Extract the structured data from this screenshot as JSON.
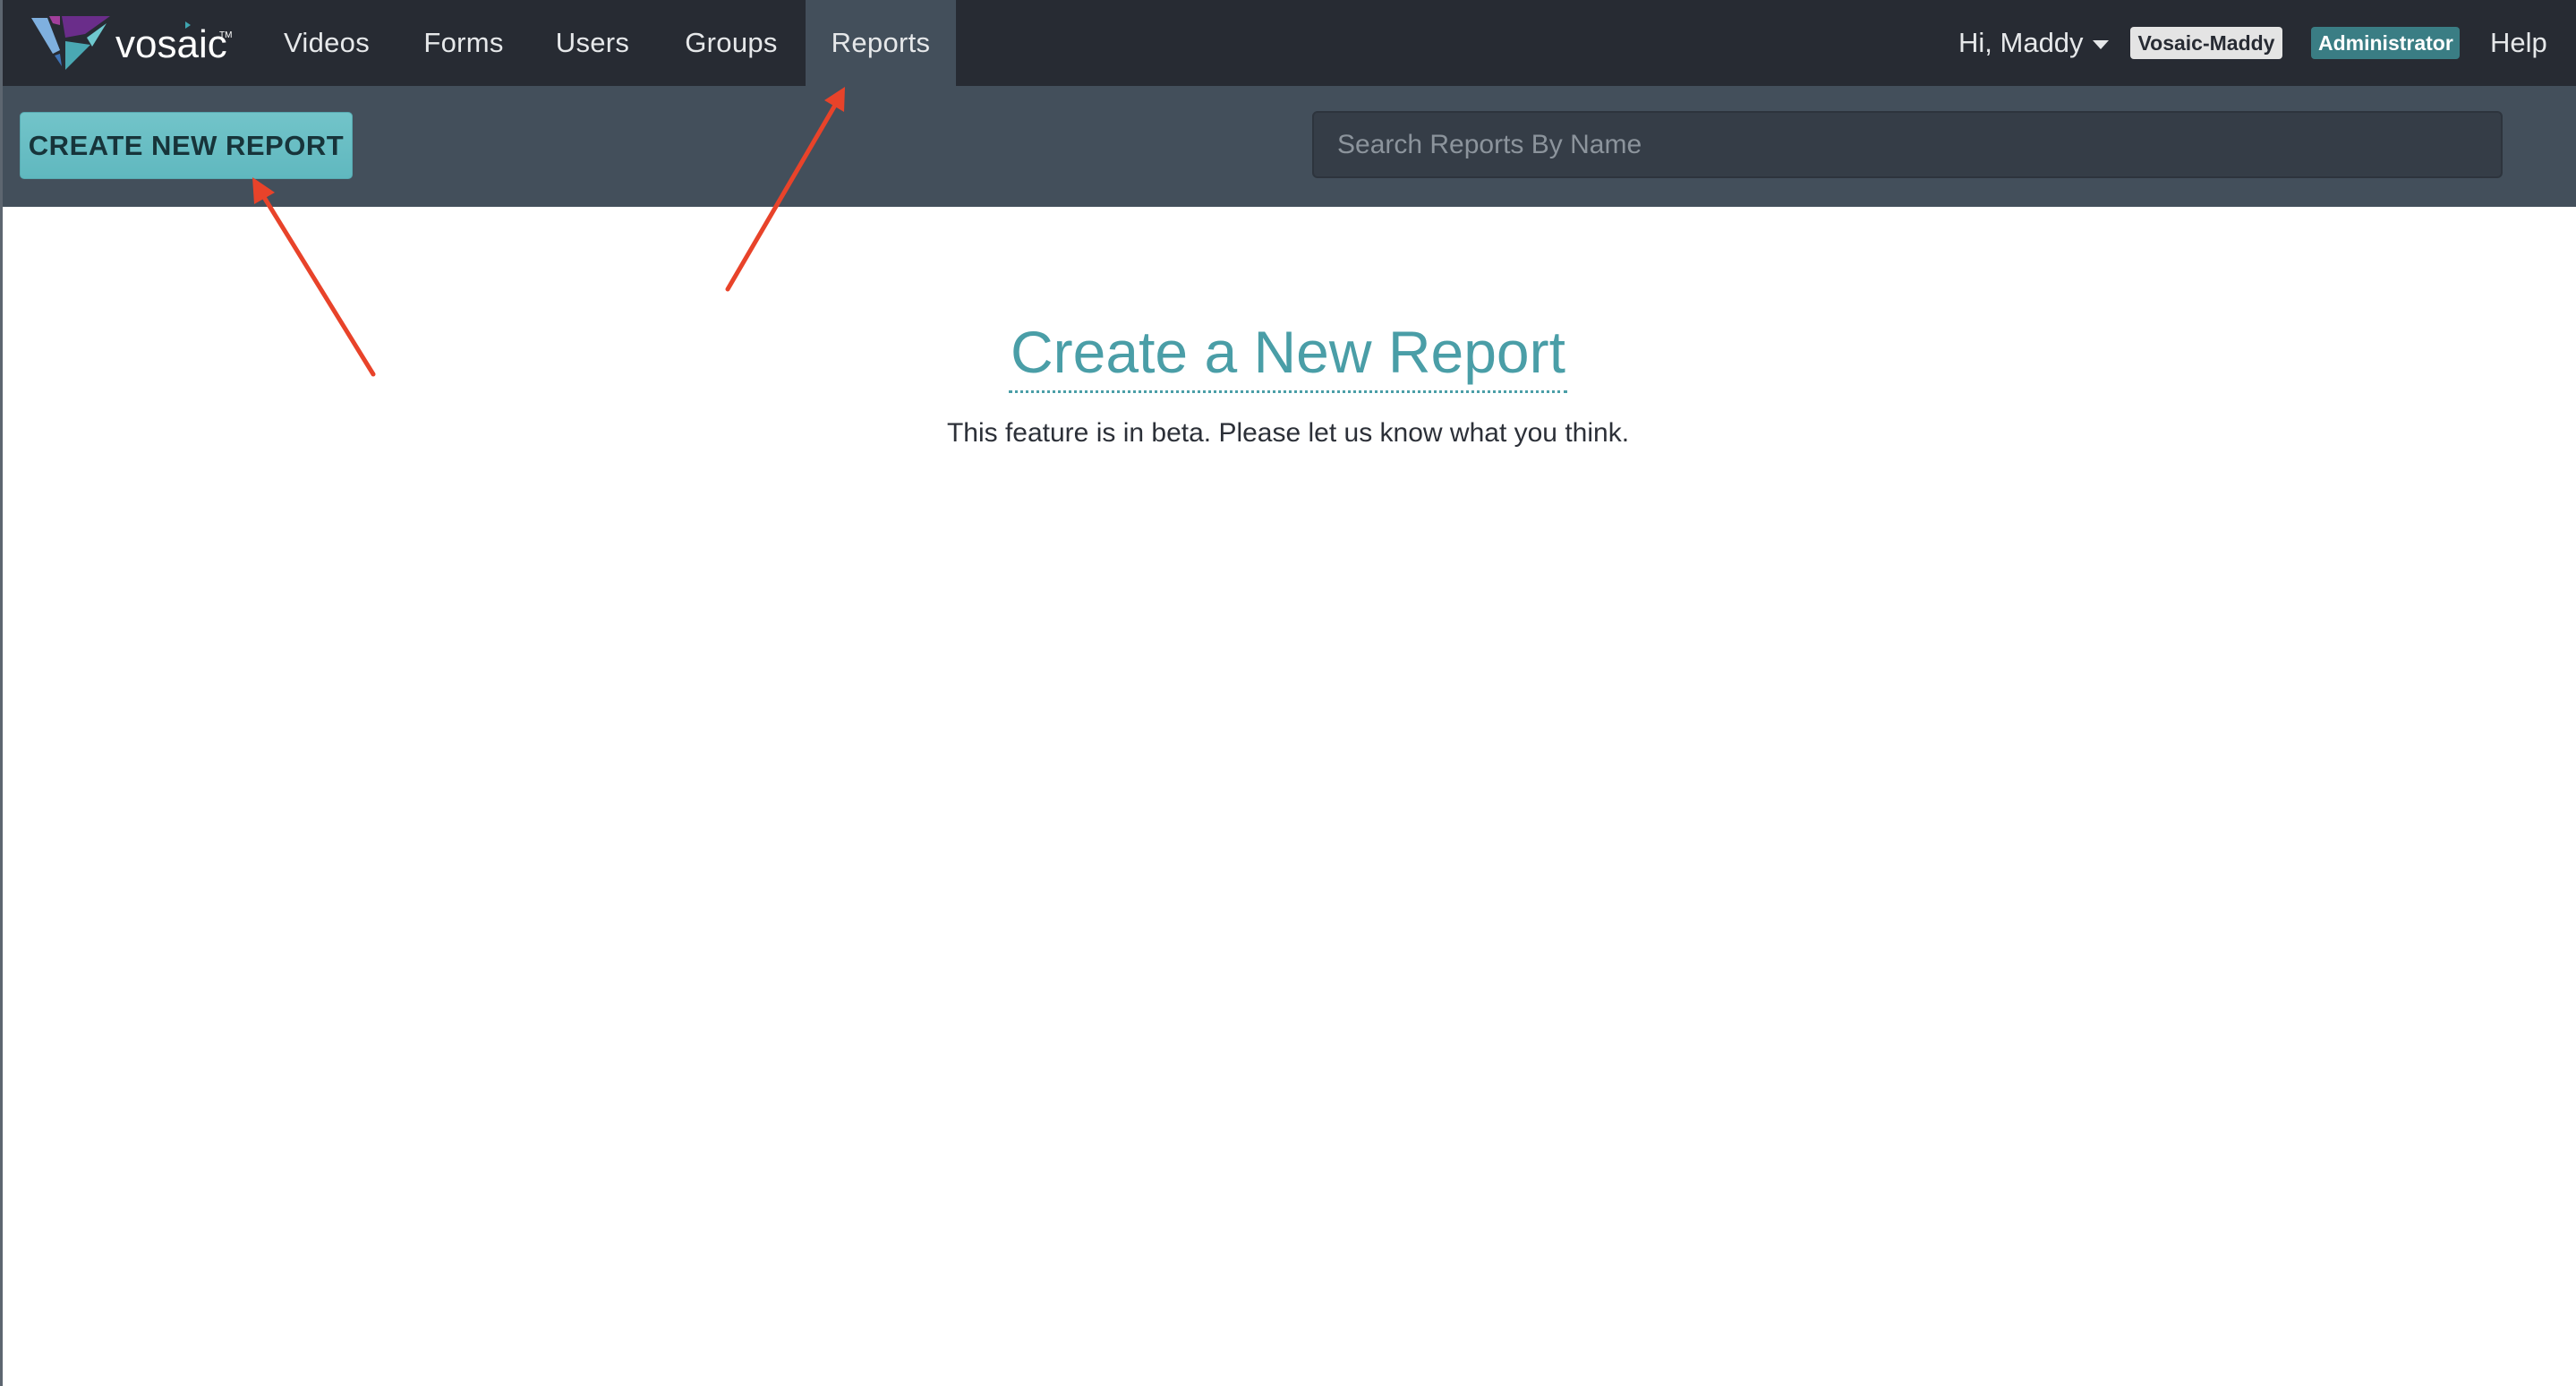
{
  "app": {
    "brand": "vosaic",
    "trademark": "TM"
  },
  "nav": {
    "items": [
      {
        "label": "Videos",
        "active": false
      },
      {
        "label": "Forms",
        "active": false
      },
      {
        "label": "Users",
        "active": false
      },
      {
        "label": "Groups",
        "active": false
      },
      {
        "label": "Reports",
        "active": true
      }
    ],
    "greeting": "Hi, Maddy",
    "account_badge": "Vosaic-Maddy",
    "role_badge": "Administrator",
    "help": "Help"
  },
  "toolbar": {
    "create_button": "CREATE NEW REPORT",
    "search_placeholder": "Search Reports By Name",
    "search_value": ""
  },
  "main": {
    "heading": "Create a New Report",
    "subtitle": "This feature is in beta. Please let us know what you think."
  },
  "annotations": {
    "arrow_color": "#e8432a",
    "arrows": [
      {
        "points_to": "create-new-report-button"
      },
      {
        "points_to": "nav-reports"
      }
    ]
  },
  "colors": {
    "navbar": "#272b33",
    "subbar": "#434f5b",
    "accent": "#4a9ea7",
    "button": "#6cc0c6",
    "role_badge": "#3a7d84"
  }
}
